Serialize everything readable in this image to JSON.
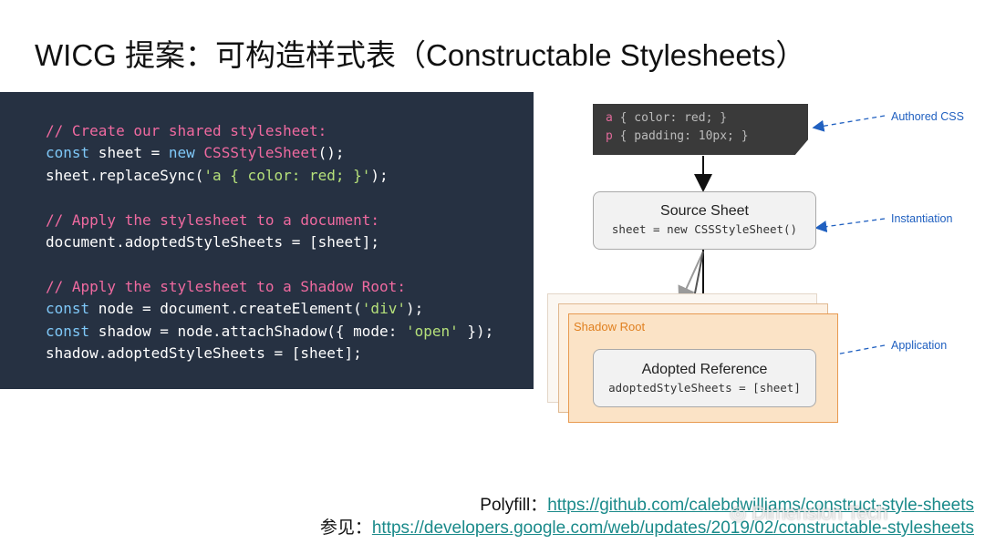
{
  "slide": {
    "title": "WICG 提案：可构造样式表（Constructable Stylesheets）"
  },
  "code": {
    "lines": [
      [
        {
          "t": "// Create our shared stylesheet:",
          "c": "comment"
        }
      ],
      [
        {
          "t": "const",
          "c": "kw"
        },
        {
          "t": " sheet = ",
          "c": "plain"
        },
        {
          "t": "new",
          "c": "kw"
        },
        {
          "t": " ",
          "c": "plain"
        },
        {
          "t": "CSSStyleSheet",
          "c": "fn"
        },
        {
          "t": "();",
          "c": "plain"
        }
      ],
      [
        {
          "t": "sheet.replaceSync(",
          "c": "plain"
        },
        {
          "t": "'a { color: red; }'",
          "c": "str"
        },
        {
          "t": ");",
          "c": "plain"
        }
      ],
      [
        {
          "t": "",
          "c": "plain"
        }
      ],
      [
        {
          "t": "// Apply the stylesheet to a document:",
          "c": "comment"
        }
      ],
      [
        {
          "t": "document.adoptedStyleSheets = [sheet];",
          "c": "plain"
        }
      ],
      [
        {
          "t": "",
          "c": "plain"
        }
      ],
      [
        {
          "t": "// Apply the stylesheet to a Shadow Root:",
          "c": "comment"
        }
      ],
      [
        {
          "t": "const",
          "c": "kw"
        },
        {
          "t": " node = document.createElement(",
          "c": "plain"
        },
        {
          "t": "'div'",
          "c": "str"
        },
        {
          "t": ");",
          "c": "plain"
        }
      ],
      [
        {
          "t": "const",
          "c": "kw"
        },
        {
          "t": " shadow = node.attachShadow({ mode: ",
          "c": "plain"
        },
        {
          "t": "'open'",
          "c": "str"
        },
        {
          "t": " });",
          "c": "plain"
        }
      ],
      [
        {
          "t": "shadow.adoptedStyleSheets = [sheet];",
          "c": "plain"
        }
      ]
    ]
  },
  "diagram": {
    "authored_css": {
      "line1_selector": "a",
      "line1_body": " { color: red; }",
      "line2_selector": "p",
      "line2_body": " { padding: 10px; }"
    },
    "source_sheet": {
      "name": "Source Sheet",
      "code": "sheet = new CSSStyleSheet()"
    },
    "shadow_root_label": "Shadow Root",
    "adopted_reference": {
      "name": "Adopted Reference",
      "code": "adoptedStyleSheets = [sheet]"
    },
    "labels": {
      "authored": "Authored CSS",
      "instantiation": "Instantiation",
      "application": "Application"
    }
  },
  "footer": {
    "polyfill_prefix": "Polyfill：",
    "polyfill_url": "https://github.com/calebdwilliams/construct-style-sheets",
    "see_also_prefix": "参见：",
    "see_also_url": "https://developers.google.com/web/updates/2019/02/constructable-stylesheets"
  },
  "watermark": {
    "text": "Dimension Tech"
  },
  "colors": {
    "code_bg": "#263142",
    "comment": "#f06aa0",
    "keyword": "#7fc8f8",
    "string": "#b5e07a",
    "link": "#1a8a8a",
    "annotation": "#2060c0",
    "shadow_border": "#e89a50"
  }
}
